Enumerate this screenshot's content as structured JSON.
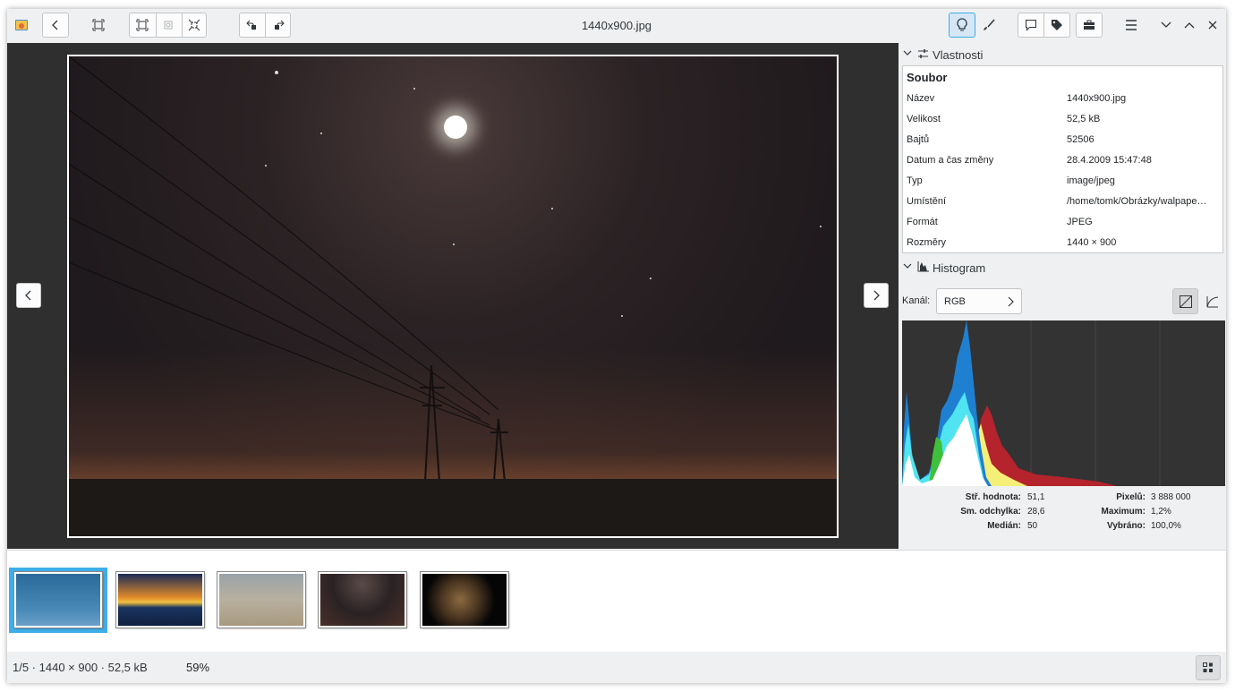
{
  "window": {
    "title": "1440x900.jpg"
  },
  "toolbar": {
    "buttons": [
      "app-icon",
      "back",
      "fullscreen",
      "zoom-fit",
      "zoom-actual",
      "zoom-fill",
      "rotate-left",
      "rotate-right",
      "info",
      "edit",
      "comment",
      "tags",
      "tools",
      "menu",
      "minimize",
      "maximize",
      "close"
    ]
  },
  "properties": {
    "section_label": "Vlastnosti",
    "group_label": "Soubor",
    "rows": [
      {
        "key": "Název",
        "value": "1440x900.jpg"
      },
      {
        "key": "Velikost",
        "value": "52,5 kB"
      },
      {
        "key": "Bajtů",
        "value": "52506"
      },
      {
        "key": "Datum a čas změny",
        "value": "28.4.2009 15:47:48"
      },
      {
        "key": "Typ",
        "value": "image/jpeg"
      },
      {
        "key": "Umístění",
        "value": "/home/tomk/Obrázky/walpape…"
      },
      {
        "key": "Formát",
        "value": "JPEG"
      },
      {
        "key": "Rozměry",
        "value": "1440 × 900"
      }
    ]
  },
  "histogram": {
    "section_label": "Histogram",
    "channel_label": "Kanál:",
    "channel_value": "RGB",
    "stats_left": [
      {
        "key": "Stř. hodnota:",
        "value": "51,1"
      },
      {
        "key": "Sm. odchylka:",
        "value": "28,6"
      },
      {
        "key": "Medián:",
        "value": "50"
      }
    ],
    "stats_right": [
      {
        "key": "Pixelů:",
        "value": "3 888 000"
      },
      {
        "key": "Maximum:",
        "value": "1,2%"
      },
      {
        "key": "Vybráno:",
        "value": "100,0%"
      }
    ],
    "colors": {
      "blue": "#1f7fd0",
      "cyan": "#4fe4f0",
      "green": "#3fc03a",
      "yellow": "#f5ef78",
      "red": "#b5232c",
      "white": "#ffffff"
    }
  },
  "filmstrip": {
    "thumbnails": [
      "night-sky-blue",
      "sunset-sea",
      "horses",
      "night-sky-moon",
      "wolf"
    ],
    "selected_index": 0
  },
  "status": {
    "info": "1/5  ·  1440 × 900  ·  52,5 kB",
    "zoom": "59%"
  },
  "accent": "#3daee9"
}
